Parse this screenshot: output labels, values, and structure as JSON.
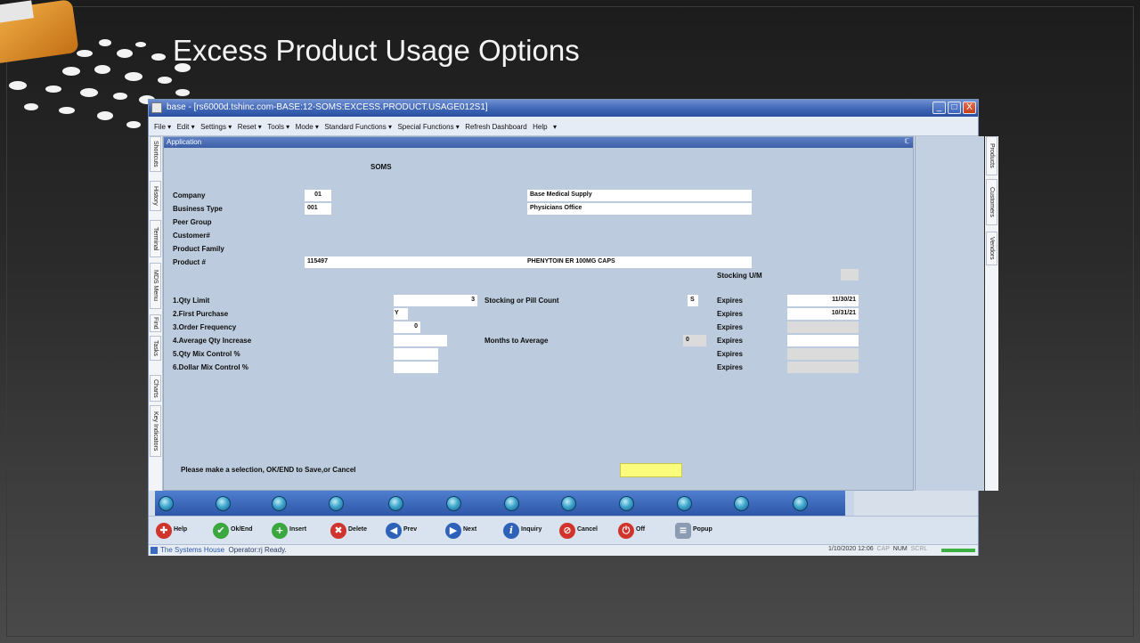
{
  "slide": {
    "title": "Excess Product Usage Options"
  },
  "window": {
    "title": "base - [rs6000d.tshinc.com-BASE:12-SOMS:EXCESS.PRODUCT.USAGE012S1]",
    "minimize": "_",
    "maximize": "□",
    "close": "X"
  },
  "menubar": [
    "File ▾",
    "Edit ▾",
    "Settings ▾",
    "Reset ▾",
    "Tools ▾",
    "Mode ▾",
    "Standard Functions ▾",
    "Special Functions ▾",
    "Refresh Dashboard",
    "Help",
    "▾"
  ],
  "left_tabs": [
    "Shortcuts",
    "History",
    "Terminal",
    "MDS Menu",
    "Find",
    "Tasks",
    "Charts",
    "Key Indicators"
  ],
  "right_tabs": [
    "Products",
    "Customers",
    "Vendors"
  ],
  "app": {
    "header": "Application",
    "pin": "ℂ",
    "module": "SOMS",
    "company_label": "Company",
    "company_code": "01",
    "company_name": "Base Medical Supply",
    "business_type_label": "Business Type",
    "business_type_code": "001",
    "business_type_name": "Physicians Office",
    "peer_group_label": "Peer Group",
    "customer_label": "Customer#",
    "product_family_label": "Product Family",
    "product_label": "Product #",
    "product_code": "115497",
    "product_name": "PHENYTOIN ER 100MG CAPS",
    "stocking_um_label": "Stocking U/M",
    "options": [
      {
        "label": "1.Qty Limit",
        "value": "3",
        "expires": "11/30/21"
      },
      {
        "label": "2.First Purchase",
        "value": "Y",
        "expires": "10/31/21"
      },
      {
        "label": "3.Order Frequency",
        "value": "0",
        "expires": ""
      },
      {
        "label": "4.Average Qty Increase",
        "value": "",
        "expires": ""
      },
      {
        "label": "5.Qty Mix Control %",
        "value": "",
        "expires": ""
      },
      {
        "label": "6.Dollar Mix Control %",
        "value": "",
        "expires": ""
      }
    ],
    "expires_label": "Expires",
    "stocking_pill_label": "Stocking or Pill Count",
    "stocking_pill_value": "S",
    "months_avg_label": "Months to Average",
    "months_avg_value": "0",
    "prompt": "Please make a selection, OK/END to Save,or Cancel"
  },
  "function_buttons": [
    {
      "label": "Help",
      "icon": "help-icon",
      "color": "#d0342c",
      "glyph": "✚"
    },
    {
      "label": "Ok/End",
      "icon": "check-icon",
      "color": "#3aa83e",
      "glyph": "✔"
    },
    {
      "label": "Insert",
      "icon": "plus-icon",
      "color": "#3aa83e",
      "glyph": "+"
    },
    {
      "label": "Delete",
      "icon": "x-icon",
      "color": "#d0342c",
      "glyph": "✖"
    },
    {
      "label": "Prev",
      "icon": "rewind-icon",
      "color": "#2d62b8",
      "glyph": "◀"
    },
    {
      "label": "Next",
      "icon": "forward-icon",
      "color": "#2d62b8",
      "glyph": "▶"
    },
    {
      "label": "Inquiry",
      "icon": "info-icon",
      "color": "#2d62b8",
      "glyph": "i"
    },
    {
      "label": "Cancel",
      "icon": "cancel-icon",
      "color": "#d0342c",
      "glyph": "⊘"
    },
    {
      "label": "Off",
      "icon": "power-icon",
      "color": "#d0342c",
      "glyph": "⏻"
    },
    {
      "label": "Popup",
      "icon": "database-icon",
      "color": "#8a9bb2",
      "glyph": "≡"
    }
  ],
  "status": {
    "company": "The Systems House",
    "text": "Operator:rj Ready.",
    "datetime": "1/10/2020 12:06",
    "cap": "CAP",
    "num": "NUM",
    "scrl": "SCRL"
  }
}
